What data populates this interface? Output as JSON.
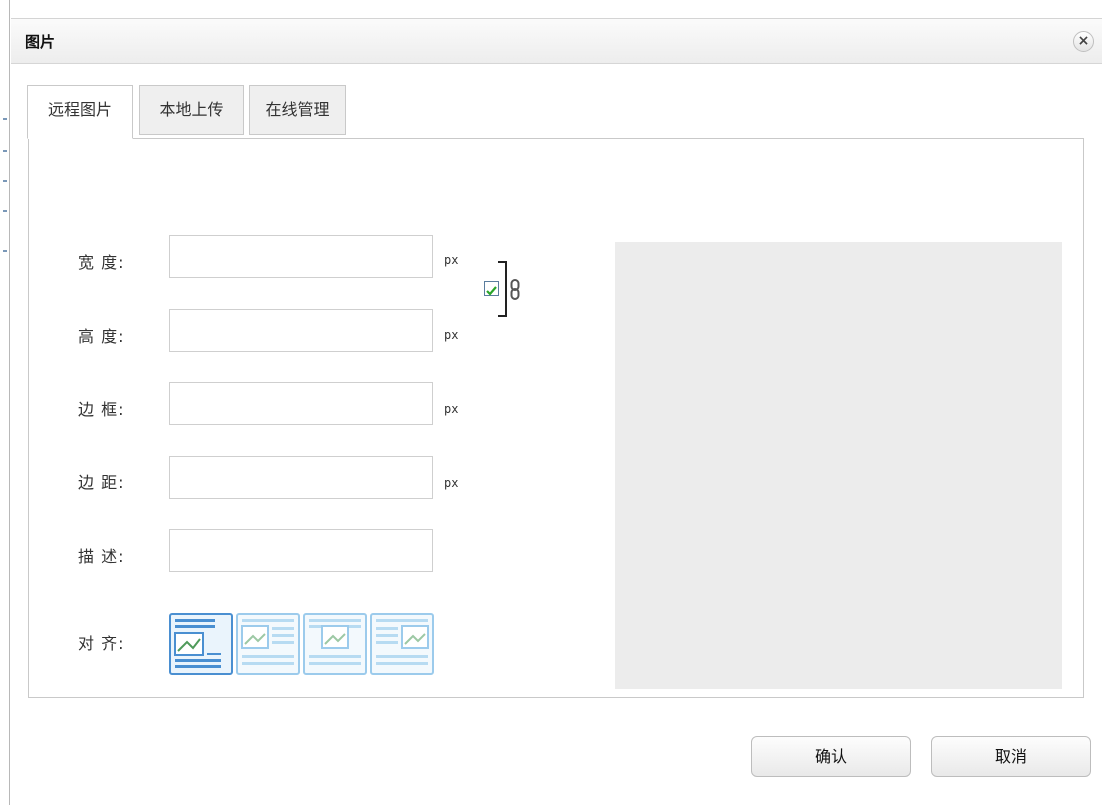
{
  "dialog": {
    "title": "图片",
    "close_icon": "close-icon"
  },
  "tabs": [
    {
      "label": "远程图片",
      "active": true
    },
    {
      "label": "本地上传",
      "active": false
    },
    {
      "label": "在线管理",
      "active": false
    }
  ],
  "form": {
    "width": {
      "label": "宽 度:",
      "value": "",
      "unit": "px"
    },
    "height": {
      "label": "高 度:",
      "value": "",
      "unit": "px"
    },
    "border": {
      "label": "边 框:",
      "value": "",
      "unit": "px"
    },
    "spacing": {
      "label": "边 距:",
      "value": "",
      "unit": "px"
    },
    "description": {
      "label": "描 述:",
      "value": ""
    },
    "align": {
      "label": "对 齐:",
      "options": [
        "none",
        "left",
        "center",
        "right"
      ],
      "selected": "none"
    },
    "lock_ratio": {
      "checked": true,
      "icon": "chain-link-icon"
    }
  },
  "preview": {
    "background": "#ececec"
  },
  "buttons": {
    "confirm": "确认",
    "cancel": "取消"
  },
  "colors": {
    "accent": "#4a8fd1",
    "check": "#2aa52a"
  }
}
